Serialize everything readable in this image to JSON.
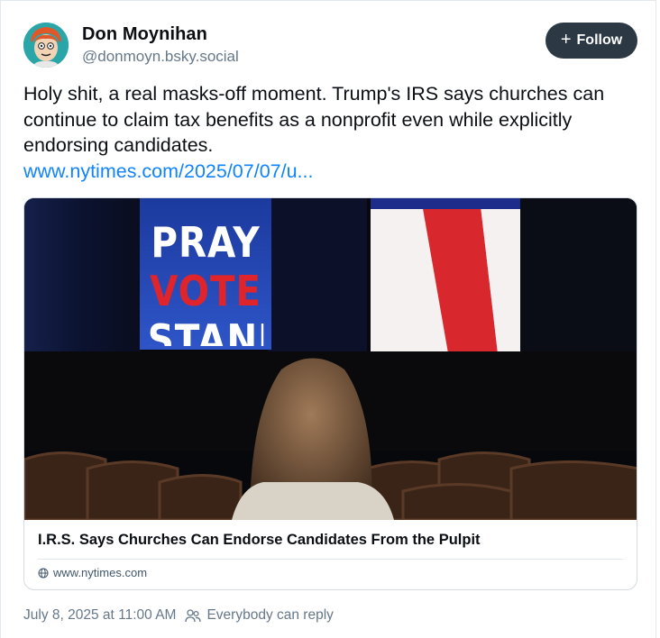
{
  "author": {
    "name": "Don Moynihan",
    "handle": "@donmoyn.bsky.social"
  },
  "follow_button": {
    "label": "Follow",
    "icon": "plus-icon"
  },
  "post": {
    "text": "Holy shit, a real masks-off moment. Trump's IRS says churches can continue to claim tax benefits as a nonprofit even while explicitly endorsing candidates.",
    "link_text": "www.nytimes.com/2025/07/07/u..."
  },
  "card": {
    "image_signage": {
      "line1": "PRAY",
      "line2": "VOTE",
      "line3": "STAND"
    },
    "title": "I.R.S. Says Churches Can Endorse Candidates From the Pulpit",
    "domain": "www.nytimes.com",
    "domain_icon": "globe-icon"
  },
  "meta": {
    "timestamp": "July 8, 2025 at 11:00 AM",
    "reply_setting": "Everybody can reply",
    "reply_icon": "people-icon"
  },
  "colors": {
    "link": "#1083fe",
    "follow_bg": "#2c3844",
    "secondary_text": "#66788a"
  }
}
